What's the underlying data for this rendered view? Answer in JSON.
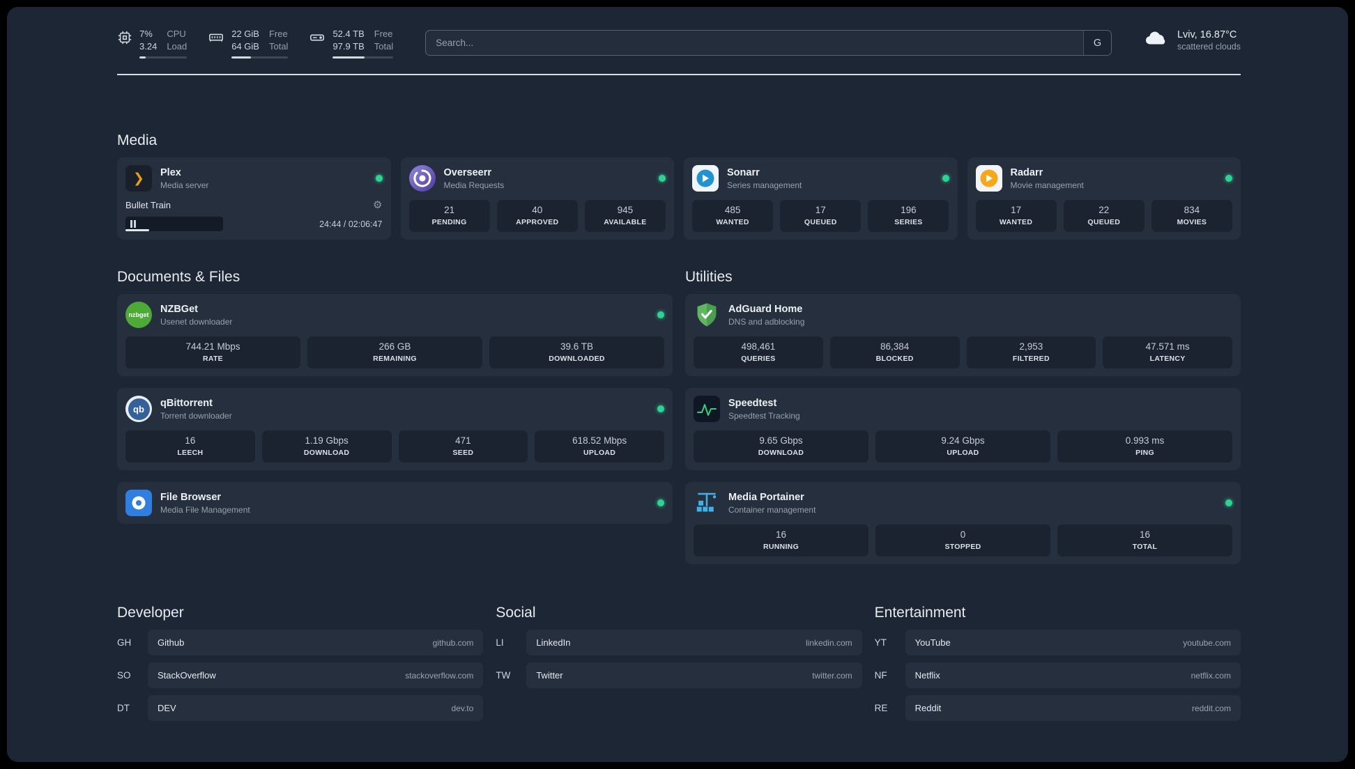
{
  "colors": {
    "status_green": "#2bd491",
    "plex_amber": "#e5a00d",
    "page_bg": "#1d2634",
    "card_bg": "#262f3e"
  },
  "icons": {
    "plex_glyph": "❯",
    "gear": "⚙",
    "nzbget_text": "nzbget",
    "qb_text": "qb"
  },
  "topbar": {
    "cpu": {
      "value1": "7%",
      "value2": "3.24",
      "label1": "CPU",
      "label2": "Load",
      "bar": 13
    },
    "memory": {
      "value1": "22 GiB",
      "value2": "64 GiB",
      "label1": "Free",
      "label2": "Total",
      "bar": 34
    },
    "disk": {
      "value1": "52.4 TB",
      "value2": "97.9 TB",
      "label1": "Free",
      "label2": "Total",
      "bar": 53
    },
    "search": {
      "placeholder": "Search...",
      "button": "G"
    },
    "weather": {
      "location": "Lviv, 16.87°C",
      "condition": "scattered clouds"
    }
  },
  "media": {
    "title": "Media",
    "plex": {
      "name": "Plex",
      "desc": "Media server",
      "now_playing": "Bullet Train",
      "time": "24:44 / 02:06:47"
    },
    "overseerr": {
      "name": "Overseerr",
      "desc": "Media Requests",
      "stats": [
        {
          "value": "21",
          "label": "PENDING"
        },
        {
          "value": "40",
          "label": "APPROVED"
        },
        {
          "value": "945",
          "label": "AVAILABLE"
        }
      ]
    },
    "sonarr": {
      "name": "Sonarr",
      "desc": "Series management",
      "stats": [
        {
          "value": "485",
          "label": "WANTED"
        },
        {
          "value": "17",
          "label": "QUEUED"
        },
        {
          "value": "196",
          "label": "SERIES"
        }
      ]
    },
    "radarr": {
      "name": "Radarr",
      "desc": "Movie management",
      "stats": [
        {
          "value": "17",
          "label": "WANTED"
        },
        {
          "value": "22",
          "label": "QUEUED"
        },
        {
          "value": "834",
          "label": "MOVIES"
        }
      ]
    }
  },
  "documents": {
    "title": "Documents & Files",
    "nzbget": {
      "name": "NZBGet",
      "desc": "Usenet downloader",
      "stats": [
        {
          "value": "744.21 Mbps",
          "label": "RATE"
        },
        {
          "value": "266 GB",
          "label": "REMAINING"
        },
        {
          "value": "39.6 TB",
          "label": "DOWNLOADED"
        }
      ]
    },
    "qbittorrent": {
      "name": "qBittorrent",
      "desc": "Torrent downloader",
      "stats": [
        {
          "value": "16",
          "label": "LEECH"
        },
        {
          "value": "1.19 Gbps",
          "label": "DOWNLOAD"
        },
        {
          "value": "471",
          "label": "SEED"
        },
        {
          "value": "618.52 Mbps",
          "label": "UPLOAD"
        }
      ]
    },
    "filebrowser": {
      "name": "File Browser",
      "desc": "Media File Management"
    }
  },
  "utilities": {
    "title": "Utilities",
    "adguard": {
      "name": "AdGuard Home",
      "desc": "DNS and adblocking",
      "stats": [
        {
          "value": "498,461",
          "label": "QUERIES"
        },
        {
          "value": "86,384",
          "label": "BLOCKED"
        },
        {
          "value": "2,953",
          "label": "FILTERED"
        },
        {
          "value": "47.571 ms",
          "label": "LATENCY"
        }
      ]
    },
    "speedtest": {
      "name": "Speedtest",
      "desc": "Speedtest Tracking",
      "stats": [
        {
          "value": "9.65 Gbps",
          "label": "DOWNLOAD"
        },
        {
          "value": "9.24 Gbps",
          "label": "UPLOAD"
        },
        {
          "value": "0.993 ms",
          "label": "PING"
        }
      ]
    },
    "portainer": {
      "name": "Media Portainer",
      "desc": "Container management",
      "stats": [
        {
          "value": "16",
          "label": "RUNNING"
        },
        {
          "value": "0",
          "label": "STOPPED"
        },
        {
          "value": "16",
          "label": "TOTAL"
        }
      ]
    }
  },
  "bookmarks": {
    "developer": {
      "title": "Developer",
      "items": [
        {
          "abbr": "GH",
          "name": "Github",
          "url": "github.com"
        },
        {
          "abbr": "SO",
          "name": "StackOverflow",
          "url": "stackoverflow.com"
        },
        {
          "abbr": "DT",
          "name": "DEV",
          "url": "dev.to"
        }
      ]
    },
    "social": {
      "title": "Social",
      "items": [
        {
          "abbr": "LI",
          "name": "LinkedIn",
          "url": "linkedin.com"
        },
        {
          "abbr": "TW",
          "name": "Twitter",
          "url": "twitter.com"
        }
      ]
    },
    "entertainment": {
      "title": "Entertainment",
      "items": [
        {
          "abbr": "YT",
          "name": "YouTube",
          "url": "youtube.com"
        },
        {
          "abbr": "NF",
          "name": "Netflix",
          "url": "netflix.com"
        },
        {
          "abbr": "RE",
          "name": "Reddit",
          "url": "reddit.com"
        }
      ]
    }
  }
}
